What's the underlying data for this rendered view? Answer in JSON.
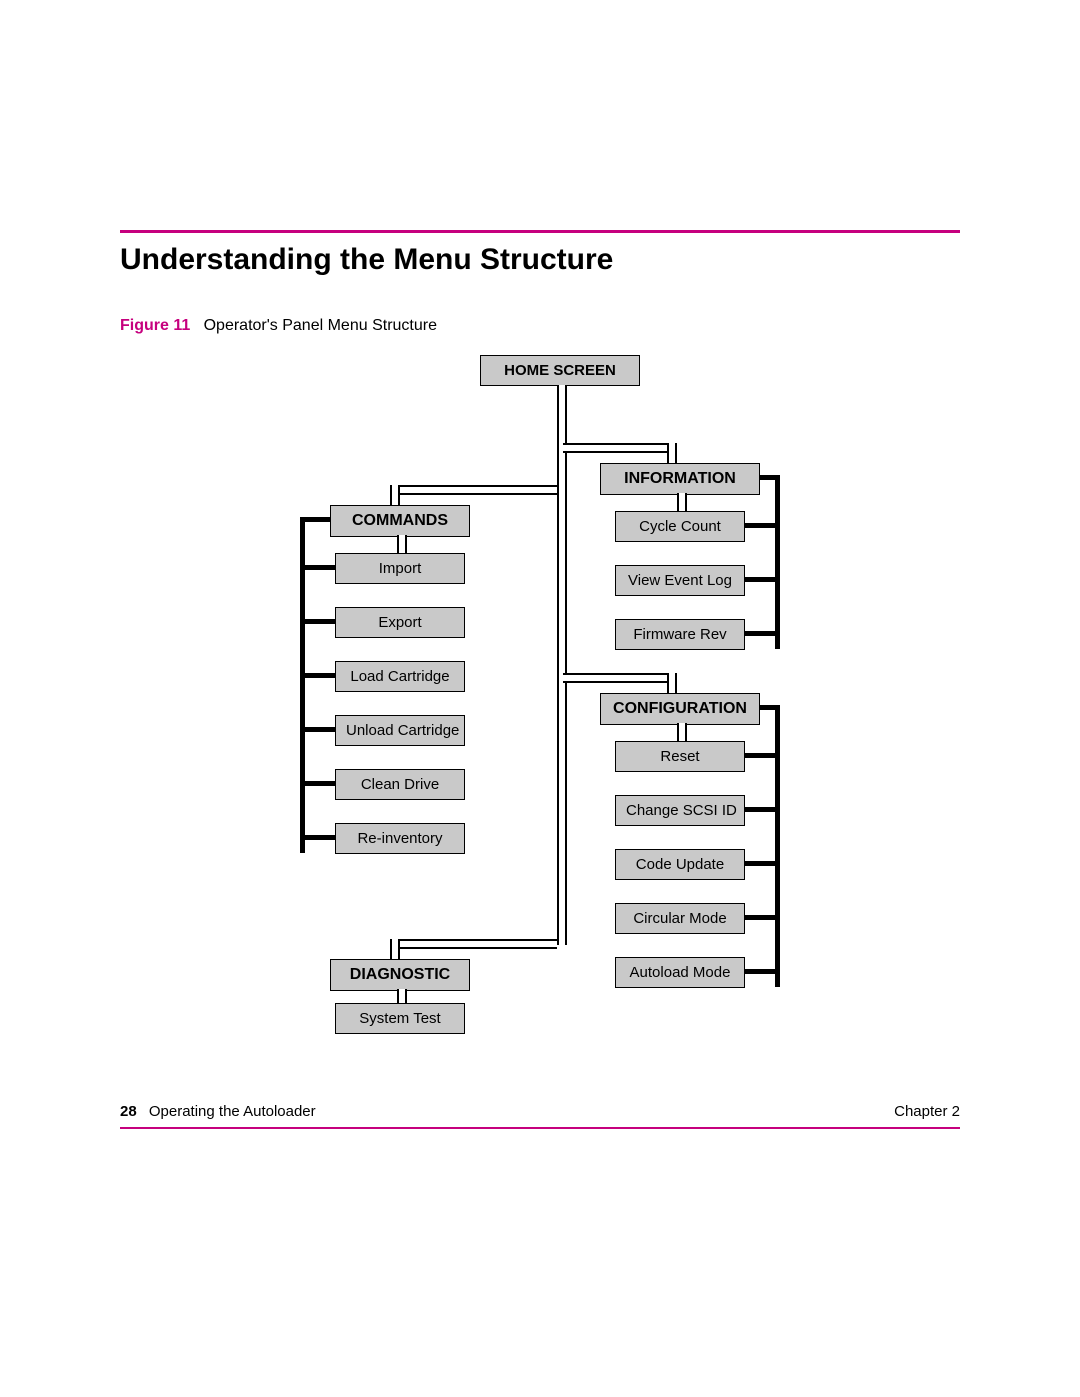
{
  "section_title": "Understanding the Menu Structure",
  "figure": {
    "label": "Figure 11",
    "caption": "Operator's Panel Menu Structure"
  },
  "menu": {
    "root": "HOME SCREEN",
    "commands": {
      "title": "COMMANDS",
      "items": [
        "Import",
        "Export",
        "Load Cartridge",
        "Unload Cartridge",
        "Clean Drive",
        "Re-inventory"
      ]
    },
    "diagnostic": {
      "title": "DIAGNOSTIC",
      "items": [
        "System Test"
      ]
    },
    "information": {
      "title": "INFORMATION",
      "items": [
        "Cycle Count",
        "View Event Log",
        "Firmware Rev"
      ]
    },
    "configuration": {
      "title": "CONFIGURATION",
      "items": [
        "Reset",
        "Change SCSI ID",
        "Code Update",
        "Circular Mode",
        "Autoload Mode"
      ]
    }
  },
  "footer": {
    "page_number": "28",
    "section": "Operating the Autoloader",
    "chapter": "Chapter 2"
  }
}
